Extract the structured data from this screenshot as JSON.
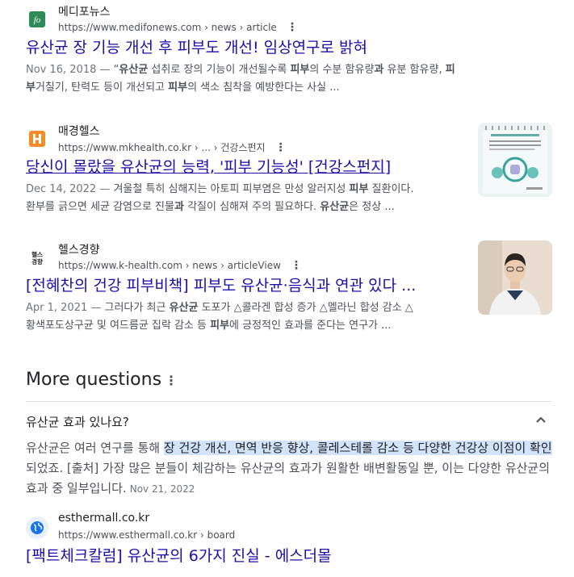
{
  "results": [
    {
      "site": "메디포뉴스",
      "url": "https://www.medifonews.com › news › article",
      "title": "유산균 장 기능 개선 후 피부도 개선! 임상연구로 밝혀",
      "date": "Nov 16, 2018 —",
      "snippet": {
        "s1": " “",
        "b1": "유산균",
        "s2": " 섭취로 장의 기능이 개선될수록 ",
        "b2": "피부",
        "s3": "의 수분 함유량",
        "b3": "과",
        "s4": " 유분 함유량, ",
        "b4": "피",
        "line2_b1": "부",
        "line2_s1": "거칠기, 탄력도 등이 개선되고 ",
        "line2_b2": "피부",
        "line2_s2": "의 색소 침착을 예방한다는 사실 ..."
      }
    },
    {
      "site": "매경헬스",
      "url": "https://www.mkhealth.co.kr › ... › 건강스펀지",
      "title": "당신이 몰랐을 유산균의 능력, '피부 기능성' [건강스펀지]",
      "date": "Dec 14, 2022 —",
      "snippet": {
        "s1": " 겨울철 특히 심해지는 아토피 피부염은 만성 알러지성 ",
        "b1": "피부",
        "s2": " 질환이다.",
        "line2_s1": "환부를 긁으면 세균 감염으로 진물",
        "line2_b1": "과",
        "line2_s2": " 각질이 심해져 주의 필요하다. ",
        "line2_b2": "유산균",
        "line2_s3": "은 정상 ..."
      }
    },
    {
      "site": "헬스경향",
      "url": "https://www.k-health.com › news › articleView",
      "title": "[전혜찬의 건강 피부비책] 피부도 유산균·음식과 연관 있다 ...",
      "date": "Apr 1, 2021 —",
      "snippet": {
        "s1": " 그러다가 최근 ",
        "b1": "유산균",
        "s2": " 도포가 △콜라겐 합성 증가 △멜라닌 합성 감소 △",
        "line2_s1": "황색포도상구균 및 여드름균 집락 감소 등 ",
        "line2_b1": "피부",
        "line2_s2": "에 긍정적인 효과를 준다는 연구가 ..."
      }
    }
  ],
  "more_questions": {
    "heading": "More questions",
    "question": "유산균 효과 있나요?",
    "answer": {
      "a1": "유산균은 여러 연구를 통해 ",
      "highlight": "장 건강 개선, 면역 반응 향상, 콜레스테롤 감소 등 다양한 건강상 이점이 확인",
      "a2": "되었죠. [출처] 가장 많은 분들이 체감하는 유산균의 효과가 원활한 배변활동일 뿐, 이는 다양한 유산균의 효과 중 일부입니다.",
      "date": "Nov 21, 2022"
    },
    "source": {
      "site": "esthermall.co.kr",
      "url": "https://www.esthermall.co.kr › board",
      "title": "[팩트체크칼럼] 유산균의 6가지 진실 - 에스더몰"
    }
  },
  "icons": {
    "result1_favicon_text": "fo",
    "result3_favicon_text": "헬스\n경향"
  }
}
